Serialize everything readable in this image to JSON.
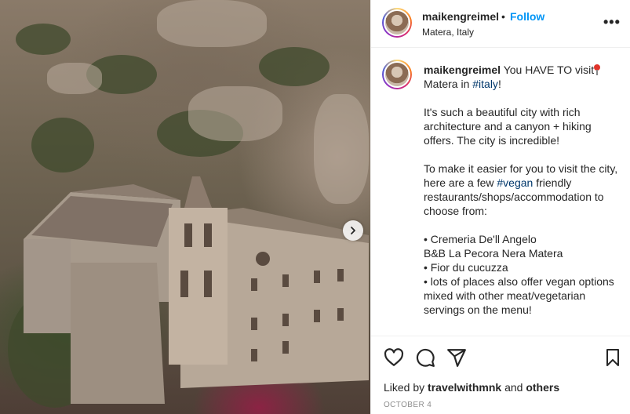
{
  "post": {
    "author": "maikengreimel",
    "follow_label": "Follow",
    "separator": "•",
    "location": "Matera, Italy",
    "more_label": "•••"
  },
  "caption": {
    "author": "maikengreimel",
    "line1_text": "You HAVE TO visit",
    "line2_prefix": "Matera in ",
    "line2_tag": "#italy",
    "line2_suffix": "!",
    "para2": "It's such a beautiful city with rich architecture and a canyon + hiking offers. The city is incredible!",
    "para3_prefix": "To make it easier for you to visit the city, here are a few ",
    "para3_tag": "#vegan",
    "para3_suffix": " friendly restaurants/shops/accommodation to choose from:",
    "list": [
      "• Cremeria De'll Angelo",
      "B&B La Pecora Nera Matera",
      "• Fior du cucuzza",
      "• lots of places also offer vegan options mixed with other meat/vegetarian servings on the menu!"
    ]
  },
  "engagement": {
    "liked_by_prefix": "Liked by ",
    "liked_by_user": "travelwithmnk",
    "liked_by_middle": " and ",
    "liked_by_others": "others",
    "date": "OCTOBER 4"
  },
  "icons": {
    "like": "heart-icon",
    "comment": "comment-icon",
    "share": "share-icon",
    "save": "bookmark-icon",
    "next": "chevron-right-icon",
    "pin": "round-pushpin-icon"
  },
  "colors": {
    "follow": "#0095f6",
    "hashtag": "#00376b",
    "date": "#8e8e8e",
    "divider": "#efefef"
  }
}
